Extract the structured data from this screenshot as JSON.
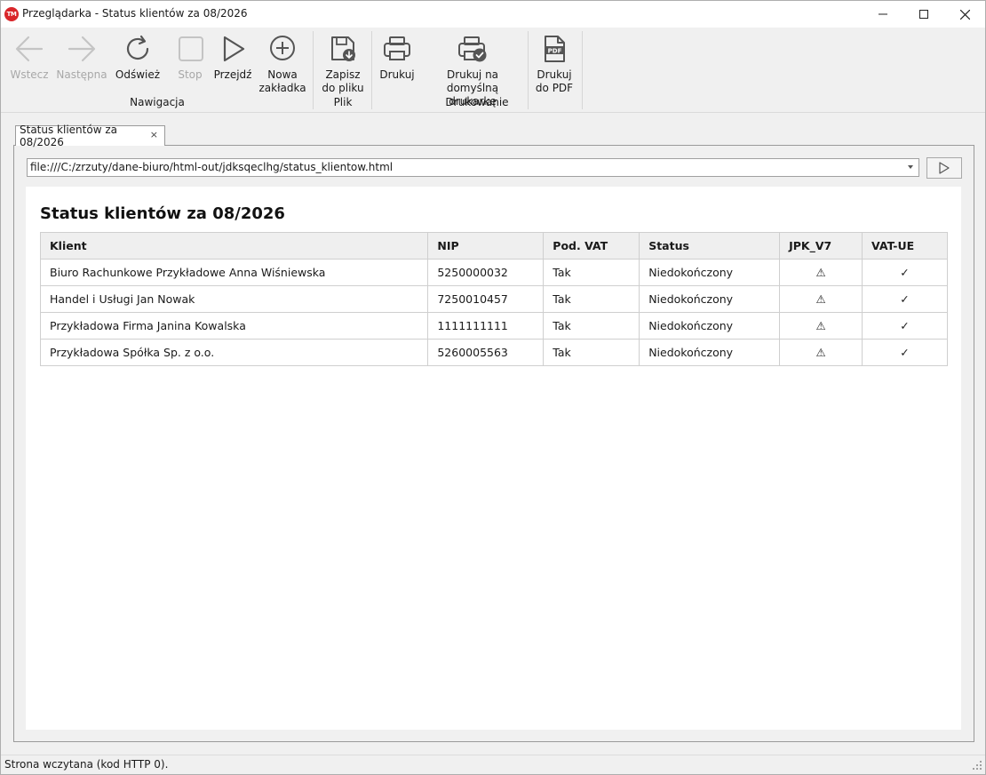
{
  "window": {
    "logo_text": "TM",
    "title": "Przeglądarka - Status klientów za 08/2026"
  },
  "ribbon": {
    "nav": {
      "back": "Wstecz",
      "forward": "Następna",
      "refresh": "Odśwież",
      "stop": "Stop",
      "go": "Przejdź",
      "new_tab_line1": "Nowa",
      "new_tab_line2": "zakładka",
      "group_label": "Nawigacja"
    },
    "file": {
      "save_line1": "Zapisz",
      "save_line2": "do pliku",
      "group_label": "Plik"
    },
    "print": {
      "print": "Drukuj",
      "print_default_line1": "Drukuj na",
      "print_default_line2": "domyślną drukarkę",
      "print_pdf_line1": "Drukuj",
      "print_pdf_line2": "do PDF",
      "pdf_icon_text": "PDF",
      "group_label": "Drukowanie"
    }
  },
  "tab": {
    "label": "Status klientów za 08/2026",
    "close": "×"
  },
  "address": {
    "url": "file:///C:/zrzuty/dane-biuro/html-out/jdksqeclhg/status_klientow.html"
  },
  "page": {
    "title": "Status klientów za 08/2026",
    "columns": [
      "Klient",
      "NIP",
      "Pod. VAT",
      "Status",
      "JPK_V7",
      "VAT-UE"
    ],
    "rows": [
      {
        "client": "Biuro Rachunkowe Przykładowe Anna Wiśniewska",
        "nip": "5250000032",
        "vat": "Tak",
        "status": "Niedokończony",
        "jpk": "⚠",
        "vatue": "✓"
      },
      {
        "client": "Handel i Usługi Jan Nowak",
        "nip": "7250010457",
        "vat": "Tak",
        "status": "Niedokończony",
        "jpk": "⚠",
        "vatue": "✓"
      },
      {
        "client": "Przykładowa Firma Janina Kowalska",
        "nip": "1111111111",
        "vat": "Tak",
        "status": "Niedokończony",
        "jpk": "⚠",
        "vatue": "✓"
      },
      {
        "client": "Przykładowa Spółka Sp. z o.o.",
        "nip": "5260005563",
        "vat": "Tak",
        "status": "Niedokończony",
        "jpk": "⚠",
        "vatue": "✓"
      }
    ]
  },
  "statusbar": {
    "text": "Strona wczytana (kod HTTP 0)."
  },
  "colors": {
    "logo": "#d9262a",
    "icon_active": "#555555",
    "icon_disabled": "#c4c4c4"
  }
}
